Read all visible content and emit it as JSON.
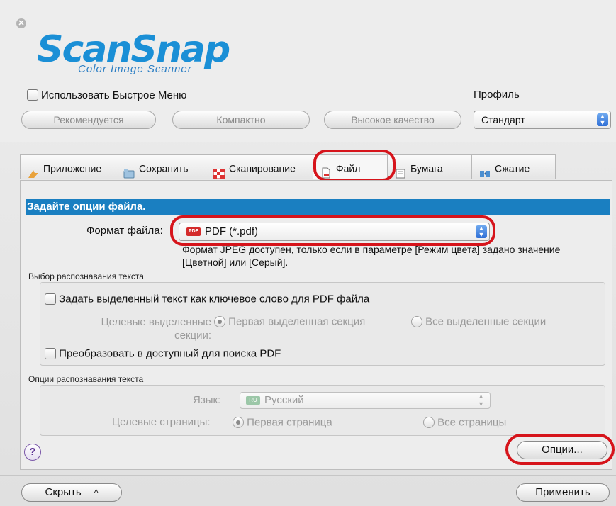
{
  "app": {
    "logo_main": "ScanSnap",
    "logo_sub": "Color Image Scanner",
    "close_glyph": "✕"
  },
  "header": {
    "quick_menu_label": "Использовать Быстрое Меню",
    "quick_menu_checked": false,
    "profile_label": "Профиль",
    "profile_value": "Стандарт",
    "modes": [
      "Рекомендуется",
      "Компактно",
      "Высокое качество"
    ]
  },
  "tabs": [
    {
      "label": "Приложение",
      "icon": "application-icon",
      "selected": false
    },
    {
      "label": "Сохранить",
      "icon": "folder-icon",
      "selected": false
    },
    {
      "label": "Сканирование",
      "icon": "scan-icon",
      "selected": false
    },
    {
      "label": "Файл",
      "icon": "file-icon",
      "selected": true
    },
    {
      "label": "Бумага",
      "icon": "paper-icon",
      "selected": false
    },
    {
      "label": "Сжатие",
      "icon": "compression-icon",
      "selected": false
    }
  ],
  "panel": {
    "section_title": "Задайте опции файла.",
    "format_label": "Формат файла:",
    "format_badge": "PDF",
    "format_value": "PDF (*.pdf)",
    "format_note": "Формат JPEG доступен, только если в параметре [Режим цвета] задано значение [Цветной] или [Серый].",
    "ocr_group_title": "Выбор распознавания текста",
    "keyword_checkbox_label": "Задать выделенный текст как ключевое слово для PDF файла",
    "target_sections_label_1": "Целевые выделенные",
    "target_sections_label_2": "секции:",
    "radio_first_section": "Первая выделенная секция",
    "radio_all_sections": "Все выделенные секции",
    "searchable_checkbox_label": "Преобразовать в доступный для поиска PDF",
    "ocr_options_title": "Опции распознавания текста",
    "language_label": "Язык:",
    "language_badge": "RU",
    "language_value": "Русский",
    "target_pages_label": "Целевые страницы:",
    "radio_first_page": "Первая страница",
    "radio_all_pages": "Все страницы",
    "options_button": "Опции..."
  },
  "footer": {
    "help_glyph": "?",
    "hide_button": "Скрыть",
    "hide_arrow": "^",
    "apply_button": "Применить"
  },
  "colors": {
    "section_bar": "#1a7fc1",
    "highlight_ring": "#d6141b",
    "logo_blue": "#1a8fd6"
  }
}
